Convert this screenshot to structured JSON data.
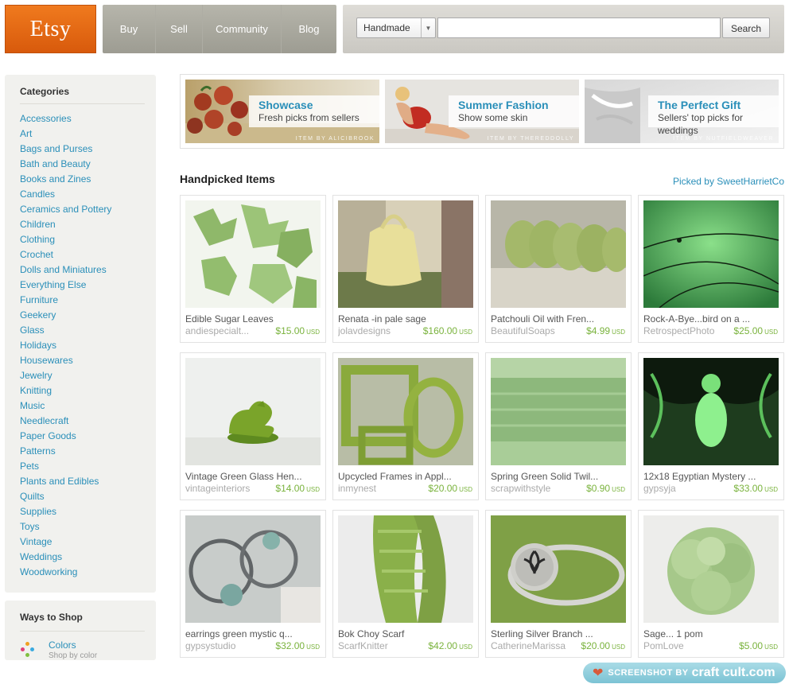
{
  "header": {
    "logo": "Etsy",
    "nav": [
      "Buy",
      "Sell",
      "Community",
      "Blog"
    ],
    "search": {
      "category": "Handmade",
      "value": "",
      "placeholder": "",
      "button": "Search"
    }
  },
  "sidebar": {
    "categories_title": "Categories",
    "categories": [
      "Accessories",
      "Art",
      "Bags and Purses",
      "Bath and Beauty",
      "Books and Zines",
      "Candles",
      "Ceramics and Pottery",
      "Children",
      "Clothing",
      "Crochet",
      "Dolls and Miniatures",
      "Everything Else",
      "Furniture",
      "Geekery",
      "Glass",
      "Holidays",
      "Housewares",
      "Jewelry",
      "Knitting",
      "Music",
      "Needlecraft",
      "Paper Goods",
      "Patterns",
      "Pets",
      "Plants and Edibles",
      "Quilts",
      "Supplies",
      "Toys",
      "Vintage",
      "Weddings",
      "Woodworking"
    ],
    "ways_title": "Ways to Shop",
    "ways": [
      {
        "label": "Colors",
        "sub": "Shop by color"
      }
    ]
  },
  "banners": [
    {
      "title": "Showcase",
      "subtitle": "Fresh picks from sellers",
      "credit": "ITEM BY ALICIBROOK"
    },
    {
      "title": "Summer Fashion",
      "subtitle": "Show some skin",
      "credit": "ITEM BY THEREDDOLLY"
    },
    {
      "title": "The Perfect Gift",
      "subtitle": "Sellers' top picks for weddings",
      "credit": "ITEM BY NUTFIELDWEAVER"
    }
  ],
  "handpicked": {
    "title": "Handpicked Items",
    "picked_by": "Picked by SweetHarrietCo",
    "currency": "USD",
    "items": [
      {
        "name": "Edible Sugar Leaves",
        "seller": "andiespecialt...",
        "price": "$15.00"
      },
      {
        "name": "Renata -in pale sage",
        "seller": "jolavdesigns",
        "price": "$160.00"
      },
      {
        "name": "Patchouli Oil with Fren...",
        "seller": "BeautifulSoaps",
        "price": "$4.99"
      },
      {
        "name": "Rock-A-Bye...bird on a ...",
        "seller": "RetrospectPhoto",
        "price": "$25.00"
      },
      {
        "name": "Vintage Green Glass Hen...",
        "seller": "vintageinteriors",
        "price": "$14.00"
      },
      {
        "name": "Upcycled Frames in Appl...",
        "seller": "inmynest",
        "price": "$20.00"
      },
      {
        "name": "Spring Green Solid Twil...",
        "seller": "scrapwithstyle",
        "price": "$0.90"
      },
      {
        "name": "12x18 Egyptian Mystery ...",
        "seller": "gypsyja",
        "price": "$33.00"
      },
      {
        "name": "earrings green mystic q...",
        "seller": "gypsystudio",
        "price": "$32.00"
      },
      {
        "name": "Bok Choy Scarf",
        "seller": "ScarfKnitter",
        "price": "$42.00"
      },
      {
        "name": "Sterling Silver Branch ...",
        "seller": "CatherineMarissa",
        "price": "$20.00"
      },
      {
        "name": "Sage... 1 pom",
        "seller": "PomLove",
        "price": "$5.00"
      }
    ]
  },
  "badge": {
    "text": "SCREENSHOT BY",
    "brand": "craft cult.com"
  }
}
